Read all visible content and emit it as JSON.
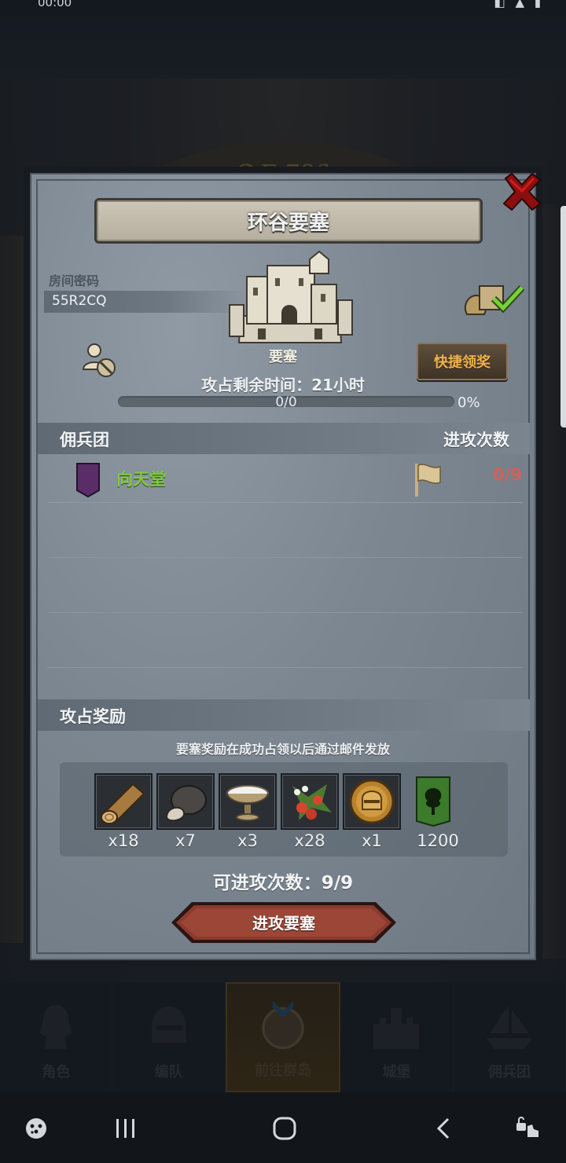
{
  "status_bar": {
    "time": "00:00",
    "icons": "◧ ▲ ▮"
  },
  "scene": {
    "year_label": "C.E.786"
  },
  "dialog": {
    "title": "环谷要塞",
    "room_password_label": "房间密码",
    "room_code": "55R2CQ",
    "fortress_label": "要塞",
    "quick_claim_label": "快捷领奖",
    "time_left": "攻占剩余时间：21小时",
    "progress": {
      "text": "0/0",
      "percent_text": "0%",
      "fraction": 0
    },
    "mercenary_section": {
      "title": "佣兵团",
      "attack_count_header": "进攻次数",
      "rows": [
        {
          "name": "向天堂",
          "count": "0/9"
        }
      ]
    },
    "reward_section": {
      "title": "攻占奖励",
      "note": "要塞奖励在成功占领以后通过邮件发放",
      "items": [
        {
          "icon": "wood-log-icon",
          "qty": "x18"
        },
        {
          "icon": "truffle-icon",
          "qty": "x7"
        },
        {
          "icon": "salt-bowl-icon",
          "qty": "x3"
        },
        {
          "icon": "berries-icon",
          "qty": "x28"
        },
        {
          "icon": "helmet-coin-icon",
          "qty": "x1"
        },
        {
          "icon": "tree-banner-icon",
          "qty": "1200"
        }
      ]
    },
    "available_attacks": "可进攻次数：9/9",
    "attack_button_label": "进攻要塞"
  },
  "bottom_nav": {
    "items": [
      {
        "label": "角色",
        "active": false
      },
      {
        "label": "编队",
        "active": false
      },
      {
        "label": "前往群岛",
        "active": true
      },
      {
        "label": "城堡",
        "active": false
      },
      {
        "label": "佣兵团",
        "active": false
      }
    ]
  },
  "colors": {
    "panel": "#7c8791",
    "gold_text": "#f0b44a",
    "green_name": "#7fca3f",
    "red_count": "#d4605a",
    "attack_button": "#8a3a2e"
  }
}
